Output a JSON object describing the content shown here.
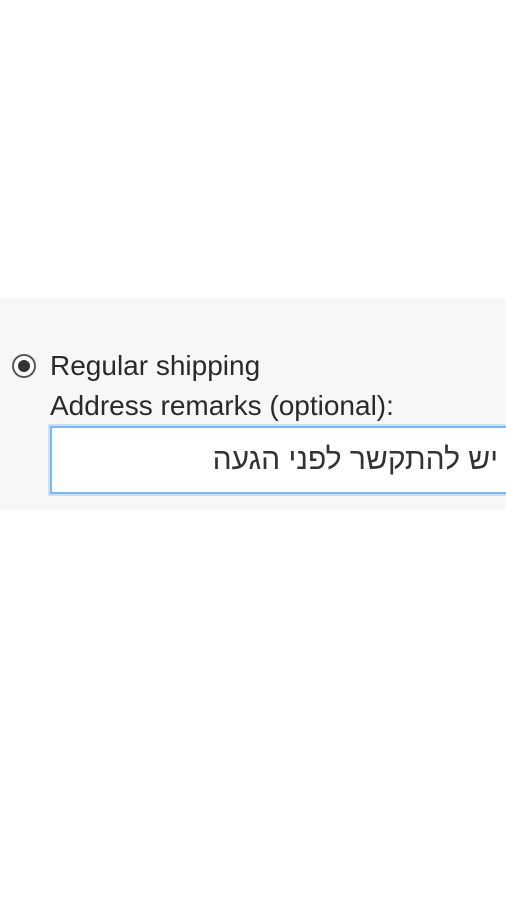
{
  "shipping": {
    "option_label": "Regular shipping",
    "remarks_label": "Address remarks (optional):",
    "remarks_value": "יש להתקשר לפני הגעה"
  }
}
